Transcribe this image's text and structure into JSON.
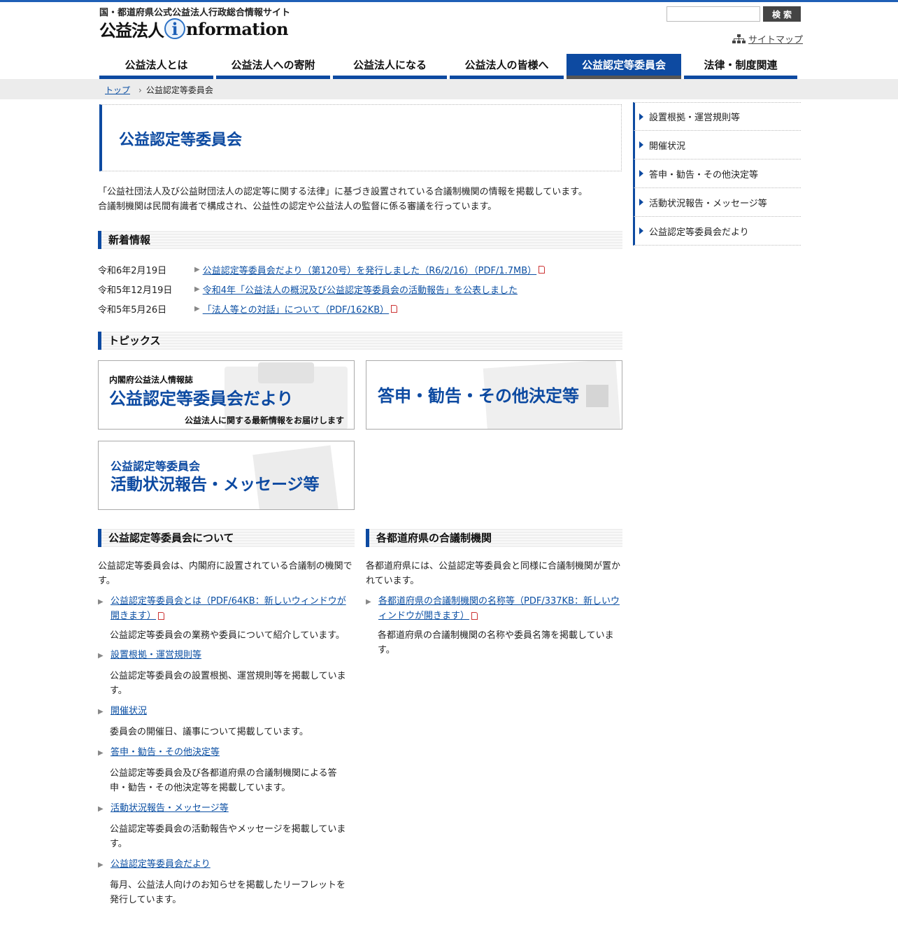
{
  "header": {
    "site_subtitle": "国・都道府県公式公益法人行政総合情報サイト",
    "logo_jp": "公益法人",
    "logo_i": "i",
    "logo_en": "nformation",
    "search_button": "検索",
    "sitemap": "サイトマップ"
  },
  "nav": {
    "items": [
      {
        "label": "公益法人とは"
      },
      {
        "label": "公益法人への寄附"
      },
      {
        "label": "公益法人になる"
      },
      {
        "label": "公益法人の皆様へ"
      },
      {
        "label": "公益認定等委員会"
      },
      {
        "label": "法律・制度関連"
      }
    ]
  },
  "breadcrumb": {
    "home": "トップ",
    "current": "公益認定等委員会"
  },
  "page": {
    "title": "公益認定等委員会",
    "intro_1": "「公益社団法人及び公益財団法人の認定等に関する法律」に基づき設置されている合議制機関の情報を掲載しています。",
    "intro_2": "合議制機関は民間有識者で構成され、公益性の認定や公益法人の監督に係る審議を行っています。"
  },
  "news": {
    "heading": "新着情報",
    "items": [
      {
        "date": "令和6年2月19日",
        "text": "公益認定等委員会だより（第120号）を発行しました（R6/2/16）（PDF/1.7MB）"
      },
      {
        "date": "令和5年12月19日",
        "text": "令和4年「公益法人の概況及び公益認定等委員会の活動報告」を公表しました"
      },
      {
        "date": "令和5年5月26日",
        "text": "「法人等との対話」について（PDF/162KB）"
      }
    ]
  },
  "topics": {
    "heading": "トピックス",
    "banner1": {
      "small": "内閣府公益法人情報誌",
      "big": "公益認定等委員会だより",
      "foot": "公益法人に関する最新情報をお届けします"
    },
    "banner2": {
      "big": "答申・勧告・その他決定等"
    },
    "banner3": {
      "small": "公益認定等委員会",
      "big": "活動状況報告・メッセージ等"
    }
  },
  "about": {
    "heading": "公益認定等委員会について",
    "intro": "公益認定等委員会は、内閣府に設置されている合議制の機関です。",
    "items": [
      {
        "link": "公益認定等委員会とは（PDF/64KB：新しいウィンドウが開きます）",
        "desc": "公益認定等委員会の業務や委員について紹介しています。"
      },
      {
        "link": "設置根拠・運営規則等",
        "desc": "公益認定等委員会の設置根拠、運営規則等を掲載しています。"
      },
      {
        "link": "開催状況",
        "desc": "委員会の開催日、議事について掲載しています。"
      },
      {
        "link": "答申・勧告・その他決定等",
        "desc": "公益認定等委員会及び各都道府県の合議制機関による答申・勧告・その他決定等を掲載しています。"
      },
      {
        "link": "活動状況報告・メッセージ等",
        "desc": "公益認定等委員会の活動報告やメッセージを掲載しています。"
      },
      {
        "link": "公益認定等委員会だより",
        "desc": "毎月、公益法人向けのお知らせを掲載したリーフレットを発行しています。"
      }
    ]
  },
  "prefectures": {
    "heading": "各都道府県の合議制機関",
    "intro": "各都道府県には、公益認定等委員会と同様に合議制機関が置かれています。",
    "link": "各都道府県の合議制機関の名称等（PDF/337KB：新しいウィンドウが開きます）",
    "desc": "各都道府県の合議制機関の名称や委員名簿を掲載しています。"
  },
  "sidenav": {
    "items": [
      {
        "label": "設置根拠・運営規則等"
      },
      {
        "label": "開催状況"
      },
      {
        "label": "答申・勧告・その他決定等"
      },
      {
        "label": "活動状況報告・メッセージ等"
      },
      {
        "label": "公益認定等委員会だより"
      }
    ]
  },
  "colors": {
    "accent": "#0d4aa1",
    "topbar": "#1e5fb6",
    "breadcrumb_bg": "#ececec"
  }
}
